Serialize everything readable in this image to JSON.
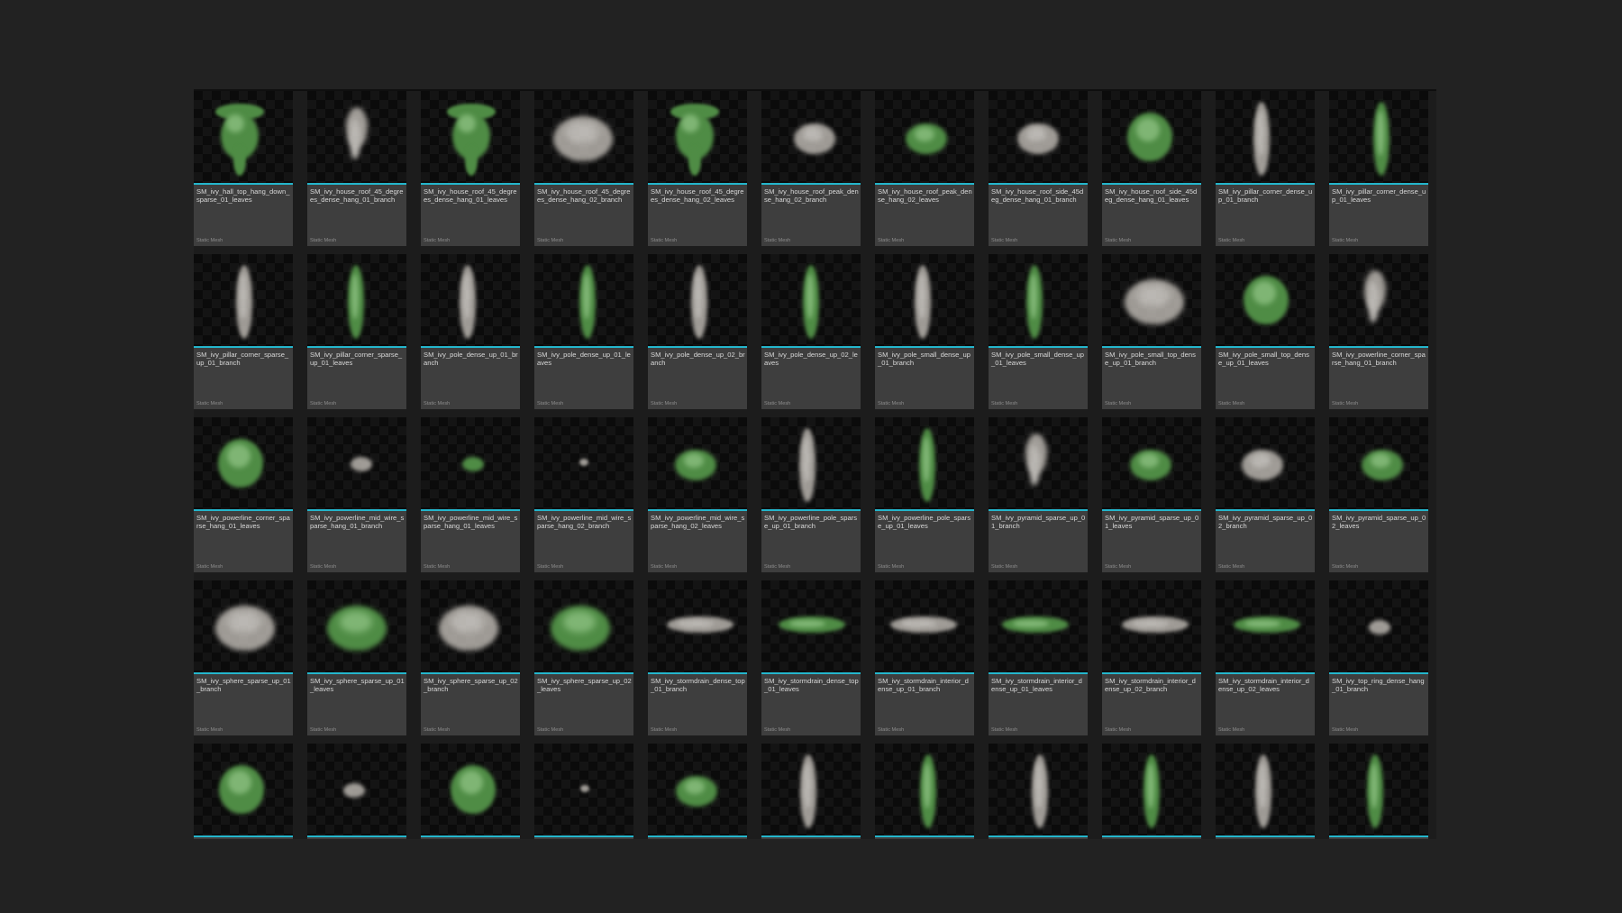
{
  "content_browser": {
    "asset_type_label": "Static Mesh",
    "accent_color": "#24b6cc",
    "assets": [
      {
        "name": "SM_ivy_hall_top_hang_down_sparse_01_leaves",
        "shape": "curtain",
        "color": "green"
      },
      {
        "name": "SM_ivy_house_roof_45_degrees_dense_hang_01_branch",
        "shape": "plume",
        "color": "white"
      },
      {
        "name": "SM_ivy_house_roof_45_degrees_dense_hang_01_leaves",
        "shape": "curtain",
        "color": "green"
      },
      {
        "name": "SM_ivy_house_roof_45_degrees_dense_hang_02_branch",
        "shape": "dome",
        "color": "white"
      },
      {
        "name": "SM_ivy_house_roof_45_degrees_dense_hang_02_leaves",
        "shape": "curtain",
        "color": "green"
      },
      {
        "name": "SM_ivy_house_roof_peak_dense_hang_02_branch",
        "shape": "mound",
        "color": "white"
      },
      {
        "name": "SM_ivy_house_roof_peak_dense_hang_02_leaves",
        "shape": "mound",
        "color": "green"
      },
      {
        "name": "SM_ivy_house_roof_side_45deg_dense_hang_01_branch",
        "shape": "mound",
        "color": "white"
      },
      {
        "name": "SM_ivy_house_roof_side_45deg_dense_hang_01_leaves",
        "shape": "bush",
        "color": "green"
      },
      {
        "name": "SM_ivy_pillar_corner_dense_up_01_branch",
        "shape": "column",
        "color": "white"
      },
      {
        "name": "SM_ivy_pillar_corner_dense_up_01_leaves",
        "shape": "column",
        "color": "green"
      },
      {
        "name": "SM_ivy_pillar_corner_sparse_up_01_branch",
        "shape": "column",
        "color": "white"
      },
      {
        "name": "SM_ivy_pillar_corner_sparse_up_01_leaves",
        "shape": "column",
        "color": "green"
      },
      {
        "name": "SM_ivy_pole_dense_up_01_branch",
        "shape": "column",
        "color": "white"
      },
      {
        "name": "SM_ivy_pole_dense_up_01_leaves",
        "shape": "column",
        "color": "green"
      },
      {
        "name": "SM_ivy_pole_dense_up_02_branch",
        "shape": "column",
        "color": "white"
      },
      {
        "name": "SM_ivy_pole_dense_up_02_leaves",
        "shape": "column",
        "color": "green"
      },
      {
        "name": "SM_ivy_pole_small_dense_up_01_branch",
        "shape": "column",
        "color": "white"
      },
      {
        "name": "SM_ivy_pole_small_dense_up_01_leaves",
        "shape": "column",
        "color": "green"
      },
      {
        "name": "SM_ivy_pole_small_top_dense_up_01_branch",
        "shape": "dome",
        "color": "white"
      },
      {
        "name": "SM_ivy_pole_small_top_dense_up_01_leaves",
        "shape": "bush",
        "color": "green"
      },
      {
        "name": "SM_ivy_powerline_corner_sparse_hang_01_branch",
        "shape": "plume",
        "color": "white"
      },
      {
        "name": "SM_ivy_powerline_corner_sparse_hang_01_leaves",
        "shape": "bush",
        "color": "green"
      },
      {
        "name": "SM_ivy_powerline_mid_wire_sparse_hang_01_branch",
        "shape": "small",
        "color": "white"
      },
      {
        "name": "SM_ivy_powerline_mid_wire_sparse_hang_01_leaves",
        "shape": "small",
        "color": "green"
      },
      {
        "name": "SM_ivy_powerline_mid_wire_sparse_hang_02_branch",
        "shape": "tiny",
        "color": "white"
      },
      {
        "name": "SM_ivy_powerline_mid_wire_sparse_hang_02_leaves",
        "shape": "mound",
        "color": "green"
      },
      {
        "name": "SM_ivy_powerline_pole_sparse_up_01_branch",
        "shape": "column",
        "color": "white"
      },
      {
        "name": "SM_ivy_powerline_pole_sparse_up_01_leaves",
        "shape": "column",
        "color": "green"
      },
      {
        "name": "SM_ivy_pyramid_sparse_up_01_branch",
        "shape": "plume",
        "color": "white"
      },
      {
        "name": "SM_ivy_pyramid_sparse_up_01_leaves",
        "shape": "mound",
        "color": "green"
      },
      {
        "name": "SM_ivy_pyramid_sparse_up_02_branch",
        "shape": "mound",
        "color": "white"
      },
      {
        "name": "SM_ivy_pyramid_sparse_up_02_leaves",
        "shape": "mound",
        "color": "green"
      },
      {
        "name": "SM_ivy_sphere_sparse_up_01_branch",
        "shape": "dome",
        "color": "white"
      },
      {
        "name": "SM_ivy_sphere_sparse_up_01_leaves",
        "shape": "dome",
        "color": "green"
      },
      {
        "name": "SM_ivy_sphere_sparse_up_02_branch",
        "shape": "dome",
        "color": "white"
      },
      {
        "name": "SM_ivy_sphere_sparse_up_02_leaves",
        "shape": "dome",
        "color": "green"
      },
      {
        "name": "SM_ivy_stormdrain_dense_top_01_branch",
        "shape": "flat",
        "color": "white"
      },
      {
        "name": "SM_ivy_stormdrain_dense_top_01_leaves",
        "shape": "flat",
        "color": "green"
      },
      {
        "name": "SM_ivy_stormdrain_interior_dense_up_01_branch",
        "shape": "flat",
        "color": "white"
      },
      {
        "name": "SM_ivy_stormdrain_interior_dense_up_01_leaves",
        "shape": "flat",
        "color": "green"
      },
      {
        "name": "SM_ivy_stormdrain_interior_dense_up_02_branch",
        "shape": "flat",
        "color": "white"
      },
      {
        "name": "SM_ivy_stormdrain_interior_dense_up_02_leaves",
        "shape": "flat",
        "color": "green"
      },
      {
        "name": "SM_ivy_top_ring_dense_hang_01_branch",
        "shape": "small",
        "color": "white"
      },
      {
        "name": "",
        "shape": "bush",
        "color": "green"
      },
      {
        "name": "",
        "shape": "small",
        "color": "white"
      },
      {
        "name": "",
        "shape": "bush",
        "color": "green"
      },
      {
        "name": "",
        "shape": "tiny",
        "color": "white"
      },
      {
        "name": "",
        "shape": "mound",
        "color": "green"
      },
      {
        "name": "",
        "shape": "column",
        "color": "white"
      },
      {
        "name": "",
        "shape": "column",
        "color": "green"
      },
      {
        "name": "",
        "shape": "column",
        "color": "white"
      },
      {
        "name": "",
        "shape": "column",
        "color": "green"
      },
      {
        "name": "",
        "shape": "column",
        "color": "white"
      },
      {
        "name": "",
        "shape": "column",
        "color": "green"
      }
    ],
    "row_4_labels_hidden": true
  },
  "colors": {
    "green": "#4f8c45",
    "green_light": "#7fb574",
    "white": "#cfcac3",
    "white_light": "#f2eee8"
  }
}
